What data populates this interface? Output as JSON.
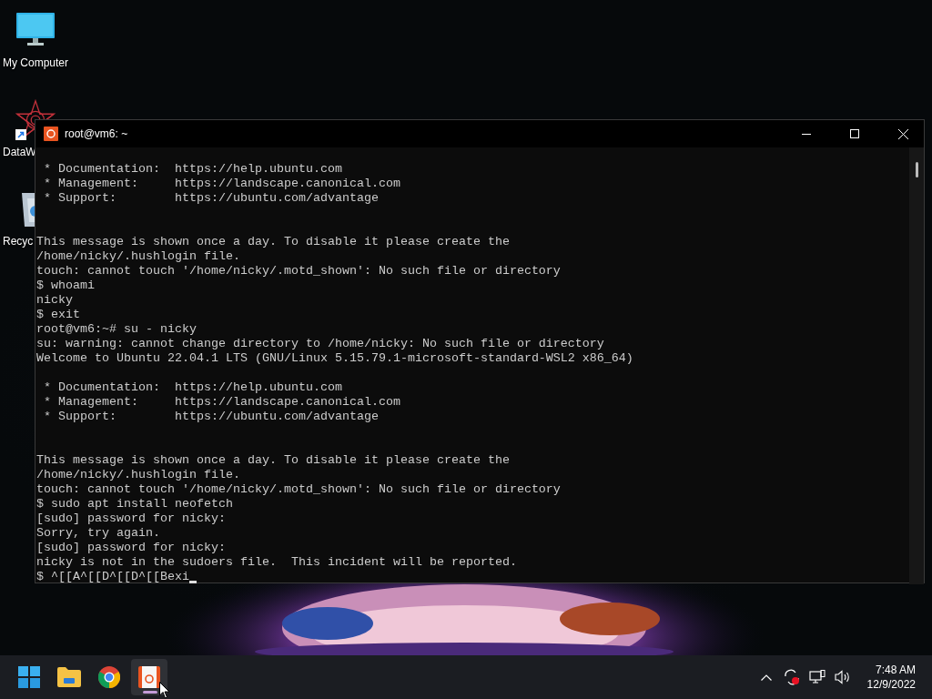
{
  "desktop_icons": [
    {
      "kind": "computer",
      "label": "My Computer",
      "shortcut": false
    },
    {
      "kind": "app",
      "label": "DataW",
      "shortcut": true
    },
    {
      "kind": "trash",
      "label": "Recyc",
      "shortcut": false
    }
  ],
  "window": {
    "title": "root@vm6: ~",
    "lines": [
      {
        "kind": "text",
        "text": " * Documentation:  https://help.ubuntu.com"
      },
      {
        "kind": "text",
        "text": " * Management:     https://landscape.canonical.com"
      },
      {
        "kind": "text",
        "text": " * Support:        https://ubuntu.com/advantage"
      },
      {
        "kind": "blank"
      },
      {
        "kind": "blank"
      },
      {
        "kind": "text",
        "text": "This message is shown once a day. To disable it please create the"
      },
      {
        "kind": "text",
        "text": "/home/nicky/.hushlogin file."
      },
      {
        "kind": "text",
        "text": "touch: cannot touch '/home/nicky/.motd_shown': No such file or directory"
      },
      {
        "kind": "text",
        "text": "$ whoami"
      },
      {
        "kind": "text",
        "text": "nicky"
      },
      {
        "kind": "text",
        "text": "$ exit"
      },
      {
        "kind": "text",
        "text": "root@vm6:~# su - nicky"
      },
      {
        "kind": "text",
        "text": "su: warning: cannot change directory to /home/nicky: No such file or directory"
      },
      {
        "kind": "text",
        "text": "Welcome to Ubuntu 22.04.1 LTS (GNU/Linux 5.15.79.1-microsoft-standard-WSL2 x86_64)"
      },
      {
        "kind": "blank"
      },
      {
        "kind": "text",
        "text": " * Documentation:  https://help.ubuntu.com"
      },
      {
        "kind": "text",
        "text": " * Management:     https://landscape.canonical.com"
      },
      {
        "kind": "text",
        "text": " * Support:        https://ubuntu.com/advantage"
      },
      {
        "kind": "blank"
      },
      {
        "kind": "blank"
      },
      {
        "kind": "text",
        "text": "This message is shown once a day. To disable it please create the"
      },
      {
        "kind": "text",
        "text": "/home/nicky/.hushlogin file."
      },
      {
        "kind": "text",
        "text": "touch: cannot touch '/home/nicky/.motd_shown': No such file or directory"
      },
      {
        "kind": "text",
        "text": "$ sudo apt install neofetch"
      },
      {
        "kind": "text",
        "text": "[sudo] password for nicky:"
      },
      {
        "kind": "text",
        "text": "Sorry, try again."
      },
      {
        "kind": "text",
        "text": "[sudo] password for nicky:"
      },
      {
        "kind": "text",
        "text": "nicky is not in the sudoers file.  This incident will be reported."
      },
      {
        "kind": "prompt",
        "text": "$ ^[[A^[[D^[[D^[[Bexi"
      }
    ]
  },
  "taskbar": {
    "apps": [
      {
        "kind": "start",
        "active": false
      },
      {
        "kind": "files",
        "active": false
      },
      {
        "kind": "browser",
        "active": false
      },
      {
        "kind": "terminal",
        "active": true
      }
    ],
    "clock": {
      "time": "7:48 AM",
      "date": "12/9/2022"
    }
  }
}
